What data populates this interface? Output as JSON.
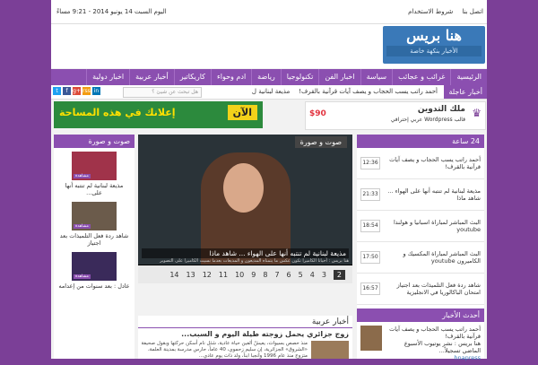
{
  "topbar": {
    "links": [
      "اتصل بنا",
      "شروط الاستخدام"
    ],
    "date": "اليوم السبت 14 يونيو 2014 - 9:21 مساءً"
  },
  "logo": {
    "title": "هنا بريس",
    "tagline": "الأخبار بنكهة خاصة"
  },
  "nav": {
    "items": [
      "الرئيسية",
      "غرائب و عجائب",
      "سياسة",
      "اخبار الفن",
      "تكنولوجيا",
      "رياضة",
      "ادم وحواء",
      "كاريكاتير",
      "أخبار عربية",
      "اخبار دولية"
    ]
  },
  "ticker": {
    "label": "أخبار عاجلة",
    "items": [
      "أحمد راتب يسب الحجاب و يصف آيات قرآنية بالقرف!",
      "مذيعة لبنانية ل"
    ],
    "search_placeholder": "هل تبحث عن شيئ ؟"
  },
  "social": [
    "t",
    "f",
    "g+",
    "rss",
    "in"
  ],
  "ads": {
    "banner_text": "إعلانك في هذه المساحة",
    "banner_now": "الآن",
    "blog_title": "ملك التدوين",
    "blog_sub": "قالب Wordpress عربي إحترافي",
    "blog_price": "$90"
  },
  "left": {
    "title": "صوت و صورة",
    "badge": "مشاهدة",
    "items": [
      {
        "caption": "مذيعة لبنانية لم تنتبه أنها على..."
      },
      {
        "caption": "شاهد ردة فعل التلميذات بعد اجتياز"
      },
      {
        "caption": "عادل : بعد سنوات من إعدامه"
      }
    ]
  },
  "center": {
    "header": "صوت و صورة",
    "caption": "مذيعة لبنانية لم تنتبه أنها على الهواء ... شاهد ماذا",
    "sub": "هنا بريس : أحيانا الكاميرا تكون عكس ما يتمناه المذيعون و المذيعات بعدما نسيت الكاميرا على التصوير",
    "pages": [
      "14",
      "13",
      "12",
      "11",
      "10",
      "9",
      "8",
      "7",
      "6",
      "5",
      "4",
      "3",
      "2"
    ],
    "active_page": "2"
  },
  "news": {
    "title": "أخبار عربية",
    "headline": "زوج جزائري يحمل زوجته طيلة اليوم و السبب...",
    "body": "منذ حصص بسيوات، يعيشُ ألفين حياة عادية، شئل نام أسكن حركتها وبقول صحيفة «الشروق» الجزائرية، إن سليم زحموي، 40 عاماً، حارس مدرسة بمدينة العلمة، متزوج منذ عام 1996 وأنجبا ابناً، ولد ذات يوم عادي..."
  },
  "right": {
    "title": "24 ساعة",
    "rows": [
      {
        "time": "12:36",
        "text": "أحمد راتب يسب الحجاب و يصف آيات قرآنية بالقرف!"
      },
      {
        "time": "21:33",
        "text": "مذيعة لبنانية لم تنتبه أنها على الهواء ... شاهد ماذا"
      },
      {
        "time": "18:54",
        "text": "البث المباشر لمباراة اسبانيا و هولندا youtube"
      },
      {
        "time": "17:50",
        "text": "البث المباشر لمباراة المكسيك و الكاميرون youtube"
      },
      {
        "time": "16:57",
        "text": "شاهد ردة فعل التلميذات بعد اجتياز امتحان الباكالوريا في الانجليزية"
      }
    ],
    "latest_title": "أحدث الأخبار",
    "latest_head": "أحمد راتب يسب الحجاب و يصف آيات قرآنية بالقرف!",
    "latest_body": "هنا بريس : نشر يوتيوب الأسبوع الماضي تسجيلاً...",
    "latest_source": "hnapress"
  },
  "colors": {
    "accent": "#8b4fb0",
    "background": "#7b3f97"
  }
}
